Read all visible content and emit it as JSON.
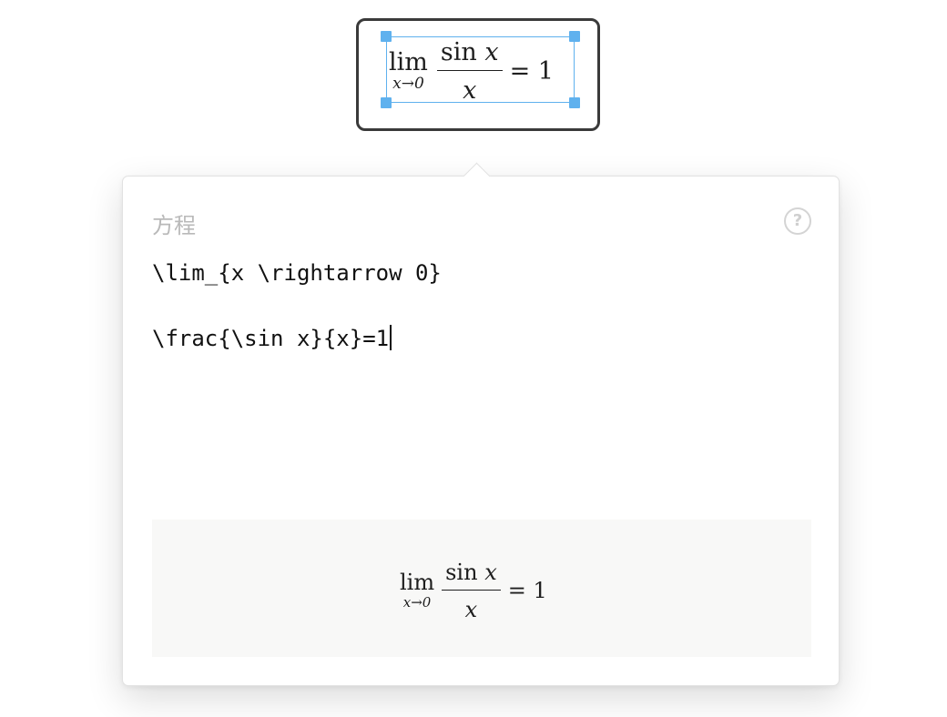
{
  "equation_object": {
    "lim": "lim",
    "subscript": "x→0",
    "numerator": "sin x",
    "denominator": "x",
    "rhs": "= 1"
  },
  "popover": {
    "title": "方程",
    "help_icon": "?",
    "editor": {
      "line1": "\\lim_{x \\rightarrow 0}",
      "line2": "\\frac{\\sin x}{x}=1"
    },
    "preview": {
      "lim": "lim",
      "subscript": "x→0",
      "numerator": "sin x",
      "denominator": "x",
      "rhs": "= 1"
    }
  },
  "colors": {
    "selection": "#5fb1ee",
    "object_border": "#3a3a3a",
    "title": "#b9b9b9",
    "preview_bg": "#f8f8f7"
  }
}
